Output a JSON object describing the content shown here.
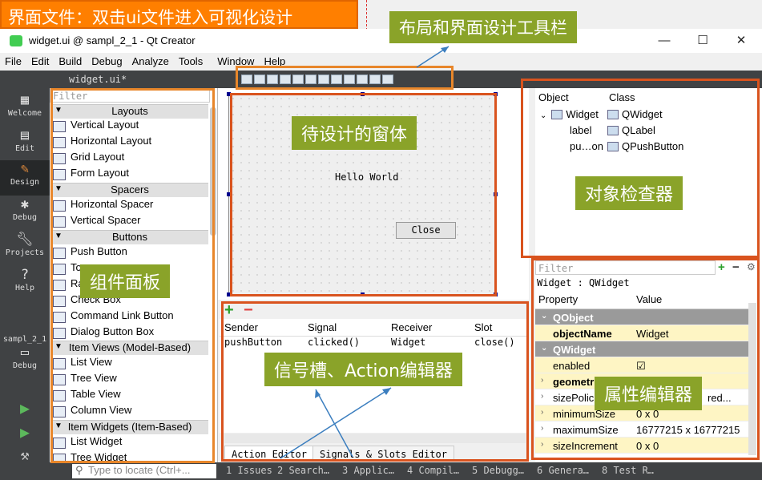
{
  "annotations": {
    "banner": "界面文件：双击ui文件进入可视化设计",
    "toolbar": "布局和界面设计工具栏",
    "form": "待设计的窗体",
    "widget_box": "组件面板",
    "object_inspector": "对象检查器",
    "signal_slot": "信号槽、Action编辑器",
    "property_editor": "属性编辑器"
  },
  "window": {
    "title": "widget.ui @ sampl_2_1 - Qt Creator",
    "minimize": "—",
    "maximize": "☐",
    "close": "✕"
  },
  "menu": [
    "File",
    "Edit",
    "Build",
    "Debug",
    "Analyze",
    "Tools",
    "Window",
    "Help"
  ],
  "modes": {
    "welcome": "Welcome",
    "edit": "Edit",
    "design": "Design",
    "debug": "Debug",
    "projects": "Projects",
    "help": "Help",
    "kit_project": "sampl_2_1",
    "kit_mode": "Debug"
  },
  "editor": {
    "file": "widget.ui*"
  },
  "widget_box": {
    "filter": "Filter",
    "layouts": "Layouts",
    "vertical_layout": "Vertical Layout",
    "horizontal_layout": "Horizontal Layout",
    "grid_layout": "Grid Layout",
    "form_layout": "Form Layout",
    "spacers": "Spacers",
    "horizontal_spacer": "Horizontal Spacer",
    "vertical_spacer": "Vertical Spacer",
    "buttons": "Buttons",
    "push_button": "Push Button",
    "tool_button": "To",
    "radio_button": "Ra",
    "check_box": "Check Box",
    "command_link": "Command Link Button",
    "dialog_button_box": "Dialog Button Box",
    "item_views": "Item Views (Model-Based)",
    "list_view": "List View",
    "tree_view": "Tree View",
    "table_view": "Table View",
    "column_view": "Column View",
    "item_widgets": "Item Widgets (Item-Based)",
    "list_widget": "List Widget",
    "tree_widget": "Tree Widget"
  },
  "form": {
    "label": "Hello World",
    "button": "Close"
  },
  "signal_slot_editor": {
    "add": "+",
    "remove": "−",
    "col_sender": "Sender",
    "col_signal": "Signal",
    "col_receiver": "Receiver",
    "col_slot": "Slot",
    "row_sender": "pushButton",
    "row_signal": "clicked()",
    "row_receiver": "Widget",
    "row_slot": "close()",
    "tab_action": "Action Editor",
    "tab_signals": "Signals & Slots Editor"
  },
  "object_inspector": {
    "col_object": "Object",
    "col_class": "Class",
    "root_object": "Widget",
    "root_class": "QWidget",
    "child1_object": "label",
    "child1_class": "QLabel",
    "child2_object": "pu…on",
    "child2_class": "QPushButton"
  },
  "property_editor": {
    "filter": "Filter",
    "class_line": "Widget : QWidget",
    "col_property": "Property",
    "col_value": "Value",
    "qobject": "QObject",
    "objectName": "objectName",
    "objectName_value": "Widget",
    "qwidget": "QWidget",
    "enabled": "enabled",
    "enabled_value": "☑",
    "geometry": "geometr",
    "sizePolicy": "sizePolic",
    "sizePolicy_value": "red...",
    "minimumSize": "minimumSize",
    "minimumSize_value": "0 x 0",
    "maximumSize": "maximumSize",
    "maximumSize_value": "16777215 x 16777215",
    "sizeIncrement": "sizeIncrement",
    "sizeIncrement_value": "0 x 0"
  },
  "statusbar": {
    "locate": "Type to locate (Ctrl+...",
    "issues": "1 Issues",
    "search": "2 Search…",
    "app": "3 Applic…",
    "compile": "4 Compil…",
    "debugger": "5 Debugg…",
    "general": "6 Genera…",
    "test": "8 Test R…"
  }
}
